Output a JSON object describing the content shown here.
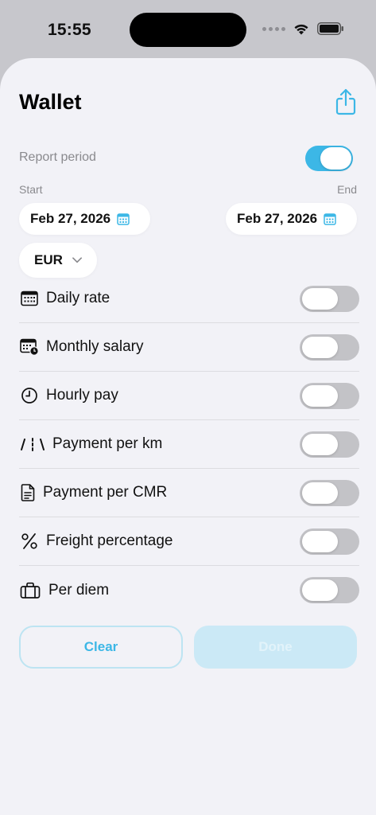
{
  "status_bar": {
    "time": "15:55"
  },
  "sheet": {
    "title": "Wallet",
    "report_period": {
      "label": "Report period",
      "enabled": true
    },
    "start": {
      "label": "Start",
      "date": "Feb 27, 2026"
    },
    "end": {
      "label": "End",
      "date": "Feb 27, 2026"
    },
    "currency": {
      "value": "EUR"
    },
    "pay_types": [
      {
        "label": "Daily rate",
        "icon": "calendar-icon",
        "enabled": false
      },
      {
        "label": "Monthly salary",
        "icon": "calendar-clock-icon",
        "enabled": false
      },
      {
        "label": "Hourly pay",
        "icon": "clock-icon",
        "enabled": false
      },
      {
        "label": "Payment per km",
        "icon": "road-icon",
        "enabled": false
      },
      {
        "label": "Payment per CMR",
        "icon": "document-icon",
        "enabled": false
      },
      {
        "label": "Freight percentage",
        "icon": "percent-icon",
        "enabled": false
      },
      {
        "label": "Per diem",
        "icon": "suitcase-icon",
        "enabled": false
      }
    ],
    "buttons": {
      "clear": "Clear",
      "done": "Done"
    }
  },
  "colors": {
    "accent": "#3cb7e6",
    "background": "#f2f2f7",
    "toggle_off": "#c3c3c7"
  }
}
